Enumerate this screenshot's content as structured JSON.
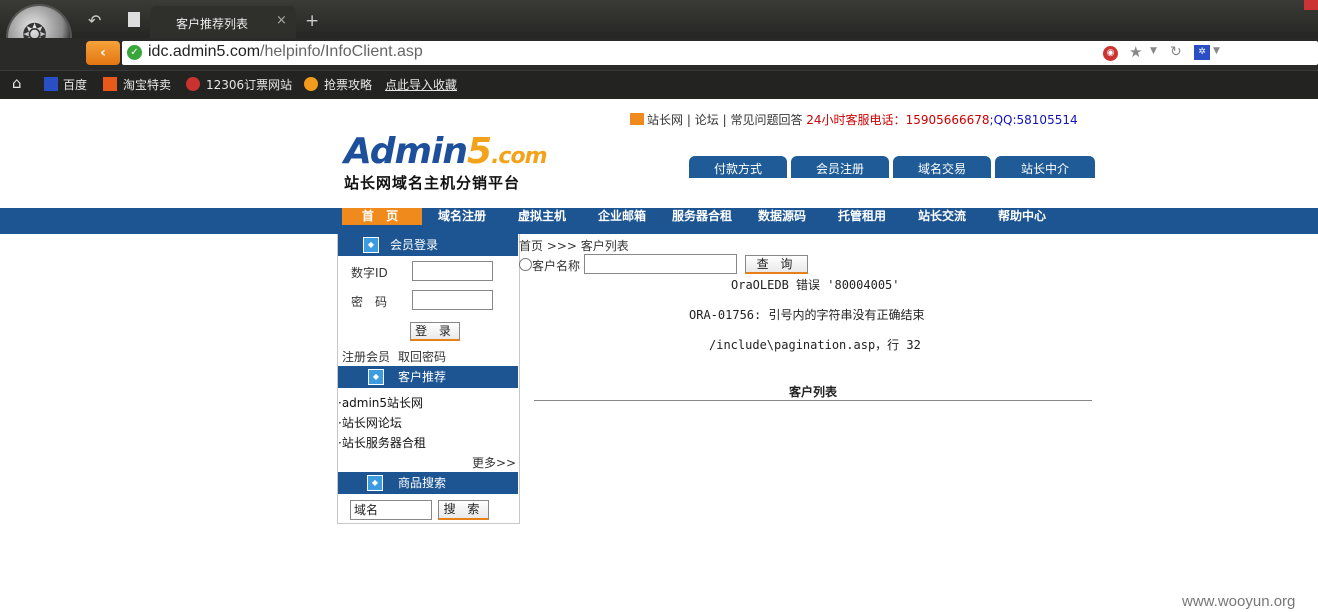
{
  "browser": {
    "tab_title": "客户推荐列表",
    "close_glyph": "×",
    "new_tab_glyph": "+",
    "url_host": "idc.admin5.com",
    "url_path": "/helpinfo/InfoClient.asp",
    "bookmarks": [
      "百度",
      "淘宝特卖",
      "12306订票网站",
      "抢票攻略",
      "点此导入收藏"
    ]
  },
  "header": {
    "site_link": "站长网",
    "forum_link": "论坛",
    "faq_link": "常见问题回答",
    "sep": "|",
    "hotline_label": "24小时客服电话：",
    "phone": "15905666678",
    "qq": ";QQ:58105514",
    "logo_text": "Admin",
    "logo_five": "5",
    "logo_com": ".com",
    "logo_sub": "站长网域名主机分销平台",
    "top_tabs": [
      "付款方式",
      "会员注册",
      "域名交易",
      "站长中介"
    ]
  },
  "nav": {
    "items": [
      "首 页",
      "域名注册",
      "虚拟主机",
      "企业邮箱",
      "服务器合租",
      "数据源码",
      "托管租用",
      "站长交流",
      "帮助中心"
    ]
  },
  "sidebar": {
    "login_title": "会员登录",
    "id_label": "数字ID",
    "pwd_label": "密　码",
    "login_btn": "登 录",
    "register_link": "注册会员",
    "forgot_link": "取回密码",
    "recommend_title": "客户推荐",
    "recommend_items": [
      "·admin5站长网",
      "·站长网论坛",
      "·站长服务器合租"
    ],
    "more_link": "更多>>",
    "search_title": "商品搜索",
    "search_value": "域名",
    "search_btn": "搜 索"
  },
  "content": {
    "breadcrumb": "首页 >>> 客户列表",
    "radio_label": "客户名称",
    "query_btn": "查 询",
    "error_line1": "OraOLEDB 错误 '80004005'",
    "error_line2": "ORA-01756: 引号内的字符串没有正确结束",
    "error_line3": "/include\\pagination.asp，行 32",
    "list_title": "客户列表"
  },
  "watermark": "www.wooyun.org",
  "colors": {
    "nav_blue": "#1d5592",
    "accent_orange": "#f18a1d",
    "phone_red": "#c00",
    "qq_blue": "#1414b4"
  }
}
